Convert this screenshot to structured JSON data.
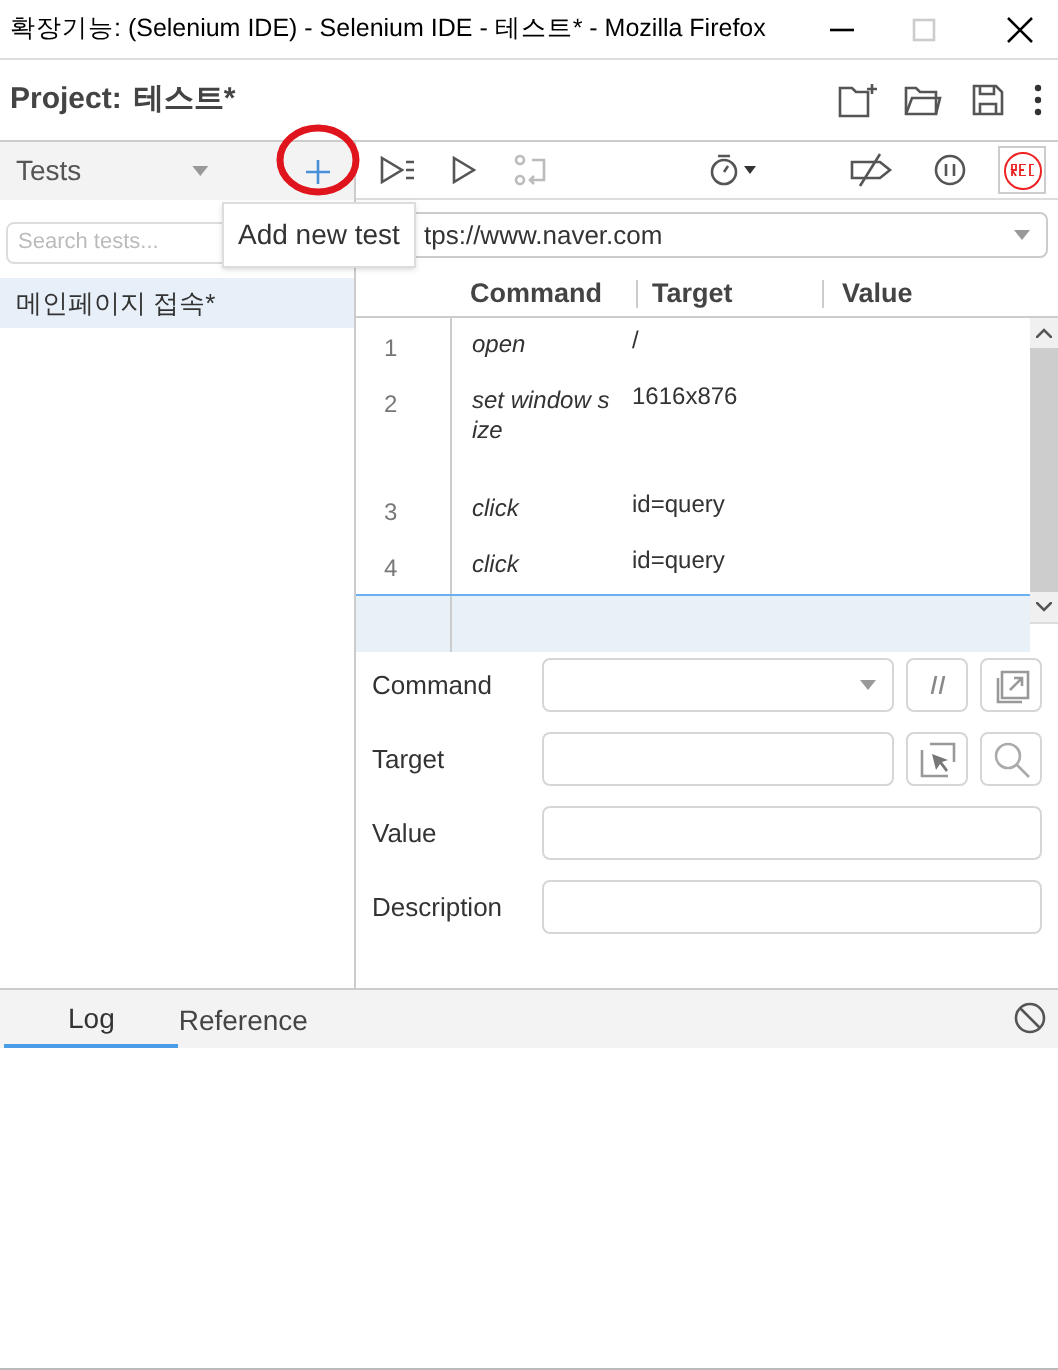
{
  "window": {
    "title": "확장기능: (Selenium IDE) - Selenium IDE - 테스트* - Mozilla Firefox"
  },
  "project": {
    "label": "Project:",
    "name": "테스트*"
  },
  "tests_panel": {
    "title": "Tests",
    "search": {
      "placeholder": "Search tests..."
    },
    "tests": [
      {
        "name": "메인페이지 접속*",
        "selected": true
      }
    ]
  },
  "tooltip": "Add new test",
  "url": "tps://www.naver.com",
  "table": {
    "columns": [
      "Command",
      "Target",
      "Value"
    ],
    "rows": [
      {
        "number": "1",
        "command": "open",
        "target": "/",
        "selected": false
      },
      {
        "number": "2",
        "command": "set window s\nize",
        "target": "1616x876",
        "selected": false
      },
      {
        "number": "3",
        "command": "click",
        "target": "id=query",
        "selected": false
      },
      {
        "number": "4",
        "command": "click",
        "target": "id=query",
        "selected": false
      },
      {
        "selected": true
      }
    ]
  },
  "editor": [
    {
      "label": "Command",
      "kind": "select"
    },
    {
      "label": "Target",
      "kind": "locator"
    },
    {
      "label": "Value",
      "kind": "text"
    },
    {
      "label": "Description",
      "kind": "text"
    }
  ],
  "bottom_tabs": [
    {
      "label": "Log",
      "selected": true
    },
    {
      "label": "Reference",
      "selected": false
    }
  ]
}
